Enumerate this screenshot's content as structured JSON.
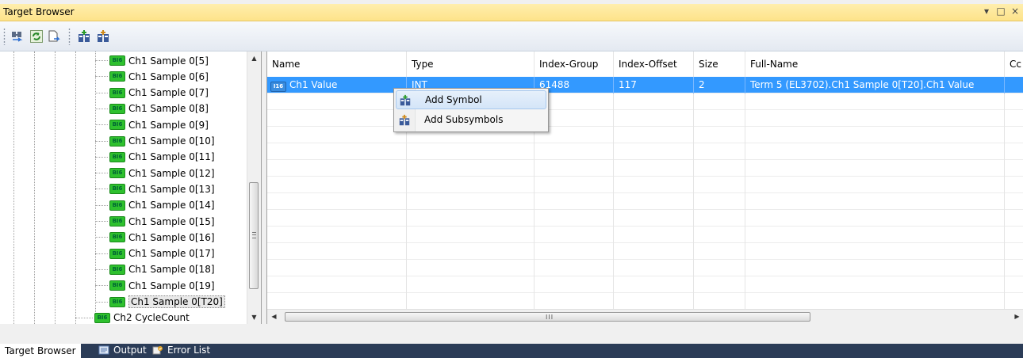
{
  "window": {
    "title": "Target Browser",
    "controls": [
      "▾",
      "□",
      "×"
    ]
  },
  "toolbar": {
    "buttons": [
      "find-icon",
      "refresh-icon",
      "document-arrow-icon",
      "add-symbol-icon",
      "add-subsymbols-icon"
    ]
  },
  "tree": {
    "items": [
      {
        "tag": "BI6",
        "label": "Ch1 Sample 0[5]"
      },
      {
        "tag": "BI6",
        "label": "Ch1 Sample 0[6]"
      },
      {
        "tag": "BI6",
        "label": "Ch1 Sample 0[7]"
      },
      {
        "tag": "BI6",
        "label": "Ch1 Sample 0[8]"
      },
      {
        "tag": "BI6",
        "label": "Ch1 Sample 0[9]"
      },
      {
        "tag": "BI6",
        "label": "Ch1 Sample 0[10]"
      },
      {
        "tag": "BI6",
        "label": "Ch1 Sample 0[11]"
      },
      {
        "tag": "BI6",
        "label": "Ch1 Sample 0[12]"
      },
      {
        "tag": "BI6",
        "label": "Ch1 Sample 0[13]"
      },
      {
        "tag": "BI6",
        "label": "Ch1 Sample 0[14]"
      },
      {
        "tag": "BI6",
        "label": "Ch1 Sample 0[15]"
      },
      {
        "tag": "BI6",
        "label": "Ch1 Sample 0[16]"
      },
      {
        "tag": "BI6",
        "label": "Ch1 Sample 0[17]"
      },
      {
        "tag": "BI6",
        "label": "Ch1 Sample 0[18]"
      },
      {
        "tag": "BI6",
        "label": "Ch1 Sample 0[19]"
      },
      {
        "tag": "BI6",
        "label": "Ch1 Sample 0[T20]"
      },
      {
        "tag": "BI6",
        "label": "Ch2 CycleCount"
      }
    ]
  },
  "grid": {
    "columns": [
      "Name",
      "Type",
      "Index-Group",
      "Index-Offset",
      "Size",
      "Full-Name",
      "Cc"
    ],
    "rows": [
      {
        "tag": "I16",
        "name": "Ch1 Value",
        "type": "INT",
        "index_group": "61488",
        "index_offset": "117",
        "size": "2",
        "full_name": "Term 5 (EL3702).Ch1 Sample 0[T20].Ch1 Value"
      }
    ]
  },
  "context_menu": {
    "items": [
      {
        "label": "Add Symbol",
        "icon": "add-symbol-icon"
      },
      {
        "label": "Add Subsymbols",
        "icon": "add-subsymbols-icon"
      }
    ]
  },
  "bottom_tabs": [
    {
      "label": "Target Browser",
      "active": true
    },
    {
      "label": "Output",
      "icon": "output-icon"
    },
    {
      "label": "Error List",
      "icon": "error-list-icon"
    }
  ],
  "scrollbar": {
    "hscroll_grip": "III"
  }
}
